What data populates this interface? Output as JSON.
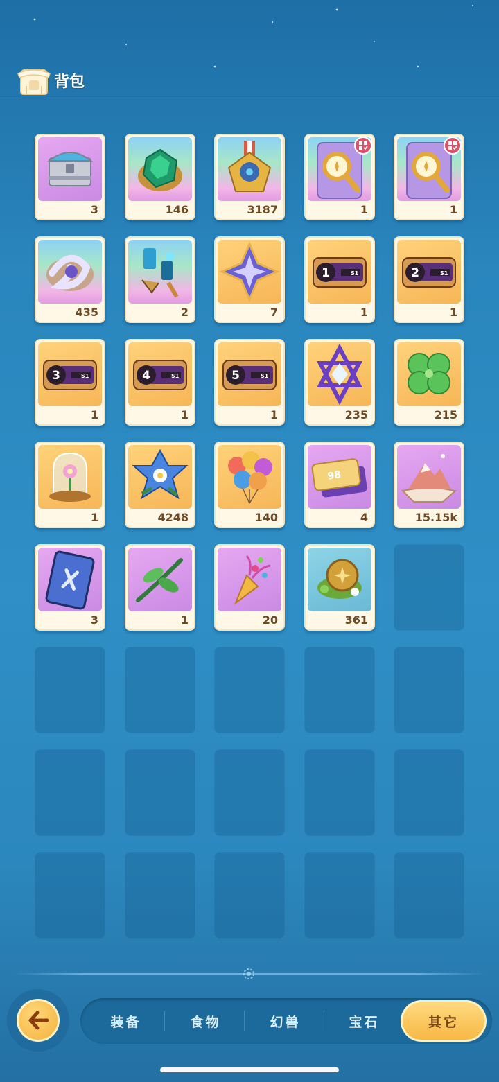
{
  "header": {
    "title": "背包",
    "icon": "backpack-icon"
  },
  "items": [
    {
      "name": "treasure-chest",
      "icon": "chest-icon",
      "count": "3",
      "bg": "purple"
    },
    {
      "name": "green-gem",
      "icon": "emerald-icon",
      "count": "146",
      "bg": "rainbow"
    },
    {
      "name": "star-medal",
      "icon": "medal-icon",
      "count": "3187",
      "bg": "rainbow"
    },
    {
      "name": "magnifier-card-1",
      "icon": "magnifier-icon",
      "count": "1",
      "bg": "rainbow",
      "badge": true
    },
    {
      "name": "magnifier-card-2",
      "icon": "magnifier-icon",
      "count": "1",
      "bg": "rainbow",
      "badge": true
    },
    {
      "name": "crystal-ring",
      "icon": "vortex-crystal-icon",
      "count": "435",
      "bg": "rainbow"
    },
    {
      "name": "mech-pieces",
      "icon": "gear-parts-icon",
      "count": "2",
      "bg": "rainbow"
    },
    {
      "name": "star-shard",
      "icon": "four-point-star-icon",
      "count": "7",
      "bg": "gold"
    },
    {
      "name": "ticket-1",
      "icon": "ticket-icon",
      "count": "1",
      "bg": "gold",
      "label": "1"
    },
    {
      "name": "ticket-2",
      "icon": "ticket-icon",
      "count": "1",
      "bg": "gold",
      "label": "2"
    },
    {
      "name": "ticket-3",
      "icon": "ticket-icon",
      "count": "1",
      "bg": "gold",
      "label": "3"
    },
    {
      "name": "ticket-4",
      "icon": "ticket-icon",
      "count": "1",
      "bg": "gold",
      "label": "4"
    },
    {
      "name": "ticket-5",
      "icon": "ticket-icon",
      "count": "1",
      "bg": "gold",
      "label": "5"
    },
    {
      "name": "hexagram-crystal",
      "icon": "hexagram-icon",
      "count": "235",
      "bg": "gold"
    },
    {
      "name": "four-leaf-clover",
      "icon": "clover-icon",
      "count": "215",
      "bg": "gold"
    },
    {
      "name": "glass-dome-flower",
      "icon": "dome-flower-icon",
      "count": "1",
      "bg": "gold"
    },
    {
      "name": "blue-flower",
      "icon": "flower-icon",
      "count": "4248",
      "bg": "gold"
    },
    {
      "name": "balloons",
      "icon": "balloons-icon",
      "count": "140",
      "bg": "gold"
    },
    {
      "name": "coupon-98",
      "icon": "coupon-icon",
      "count": "4",
      "bg": "purple",
      "label": "98"
    },
    {
      "name": "pink-mountain",
      "icon": "mountain-icon",
      "count": "15.15k",
      "bg": "purple"
    },
    {
      "name": "blue-card",
      "icon": "card-icon",
      "count": "3",
      "bg": "purple"
    },
    {
      "name": "green-twig",
      "icon": "twig-icon",
      "count": "1",
      "bg": "purple"
    },
    {
      "name": "party-popper",
      "icon": "party-popper-icon",
      "count": "20",
      "bg": "purple"
    },
    {
      "name": "gold-coin-leaves",
      "icon": "coin-icon",
      "count": "361",
      "bg": "blue"
    }
  ],
  "total_slots": 40,
  "tabs": [
    {
      "id": "equipment",
      "label": "装备",
      "active": false
    },
    {
      "id": "food",
      "label": "食物",
      "active": false
    },
    {
      "id": "beast",
      "label": "幻兽",
      "active": false
    },
    {
      "id": "gem",
      "label": "宝石",
      "active": false
    },
    {
      "id": "other",
      "label": "其它",
      "active": true
    }
  ],
  "back_button": {
    "icon": "back-arrow-icon"
  },
  "colors": {
    "accent": "#f7b945",
    "count_text": "#6e4a26",
    "background": "#2a86bd"
  }
}
